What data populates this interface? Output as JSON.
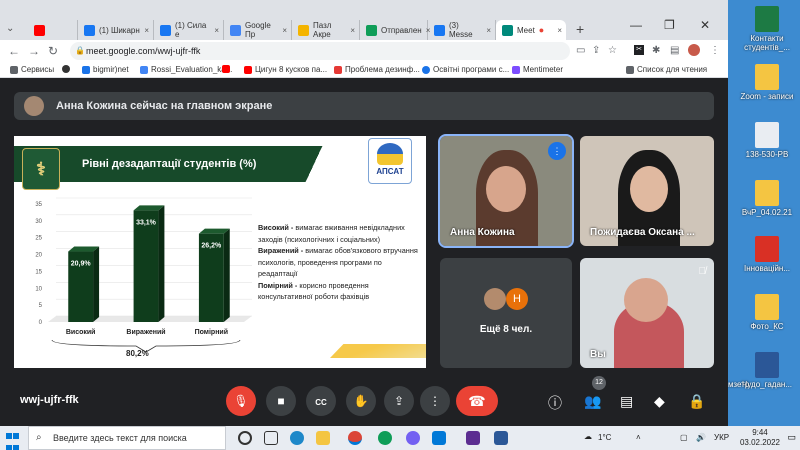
{
  "desktop": {
    "icons": [
      {
        "label": "Контакти студентів_...",
        "color": "#1d7a44"
      },
      {
        "label": "Zoom - записи",
        "color": "#f4c542"
      },
      {
        "label": "138-530-РВ",
        "color": "#e9edf2"
      },
      {
        "label": "ВчР_04.02.21",
        "color": "#f4c542"
      },
      {
        "label": "Інноваційн...",
        "color": "#d93025"
      },
      {
        "label": "Фото_КС",
        "color": "#f4c542"
      },
      {
        "label": "Чудо_гадан...",
        "color": "#2b5797"
      }
    ],
    "partial_label": "мзетр"
  },
  "browser": {
    "tabs": [
      {
        "title": "(1) Шикарн",
        "color": "#1877f2"
      },
      {
        "title": "(1) Сила е",
        "color": "#1877f2"
      },
      {
        "title": "Google Пр",
        "color": "#4285f4"
      },
      {
        "title": "Пазл Акре",
        "color": "#f4b400"
      },
      {
        "title": "Отправлен",
        "color": "#0f9d58"
      },
      {
        "title": "(3) Messe",
        "color": "#1877f2"
      },
      {
        "title": "Meet",
        "color": "#00897b"
      }
    ],
    "new_tab": "+",
    "url": "meet.google.com/wwj-ujfr-ffk",
    "bookmarks": [
      {
        "label": "Сервисы",
        "color": "#5f6368"
      },
      {
        "label": "",
        "color": "#333333"
      },
      {
        "label": "bigmir)net",
        "color": "#1a73e8"
      },
      {
        "label": "Rossi_Evaluation_ka...",
        "color": "#4285f4"
      },
      {
        "label": "",
        "color": "#ff0000"
      },
      {
        "label": "Цигун 8 кусков па...",
        "color": "#ff0000"
      },
      {
        "label": "Проблема дезинф...",
        "color": "#e53935"
      },
      {
        "label": "Освітні програми с...",
        "color": "#1a73e8"
      },
      {
        "label": "Mentimeter",
        "color": "#7c4dff"
      }
    ],
    "reading_list": "Список для чтения"
  },
  "meet": {
    "presenting_text": "Анна Кожина сейчас на главном экране",
    "slide": {
      "title": "Рівні дезадаптації студентів (%)",
      "logo_text": "АПСАТ",
      "definitions": [
        {
          "term": "Високий -",
          "text": " вимагає вживання невідкладних заходів (психологічних і соціальних)"
        },
        {
          "term": "Виражений -",
          "text": " вимагає обов'язкового втручання психологів, проведення програми по реадаптації"
        },
        {
          "term": "Помірний -",
          "text": " корисно проведення консультативної роботи фахівців"
        }
      ],
      "total": "80,2%"
    },
    "chart_data": {
      "type": "bar",
      "categories": [
        "Високий",
        "Виражений",
        "Помірний"
      ],
      "values": [
        20.9,
        33.1,
        26.2
      ],
      "value_labels": [
        "20,9%",
        "33,1%",
        "26,2%"
      ],
      "ylim": [
        0,
        35
      ],
      "yticks": [
        0,
        5,
        10,
        15,
        20,
        25,
        30,
        35
      ],
      "bar_color": "#0f3d1c"
    },
    "participants": [
      {
        "name": "Анна Кожина"
      },
      {
        "name": "Пожидаєва Оксана ..."
      },
      {
        "name": "Ещё 8 чел.",
        "initial": "Н"
      },
      {
        "name": "Вы"
      }
    ],
    "meeting_code": "wwj-ujfr-ffk",
    "people_count": "12"
  },
  "taskbar": {
    "search_placeholder": "Введите здесь текст для поиска",
    "temperature": "1°C",
    "language": "УКР",
    "time": "9:44",
    "date": "03.02.2022"
  }
}
